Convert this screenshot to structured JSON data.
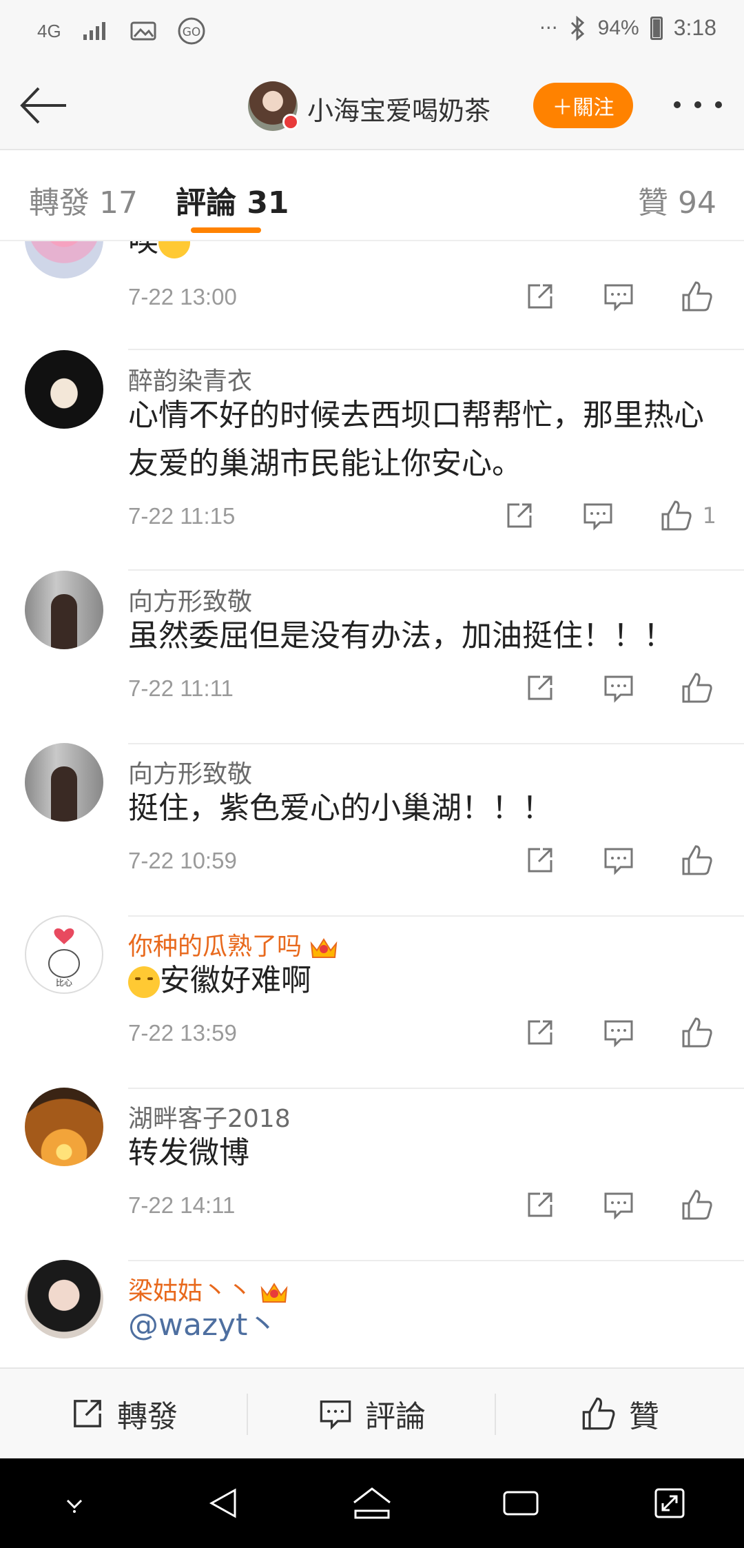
{
  "status_bar": {
    "network": "4G",
    "battery_percent": "94%",
    "time": "3:18",
    "icons": [
      "signal-icon",
      "image-icon",
      "go-icon",
      "dots-icon",
      "bluetooth-icon",
      "battery-icon"
    ]
  },
  "header": {
    "username": "小海宝爱喝奶茶",
    "follow_label": "＋關注"
  },
  "tabs": [
    {
      "label": "轉發 17"
    },
    {
      "label": "評論 31",
      "active": true
    },
    {
      "label": "贊 94"
    }
  ],
  "comments": [
    {
      "user": "",
      "text": "唉",
      "time": "7-22 13:00",
      "likes": ""
    },
    {
      "user": "醉韵染青衣",
      "text": "心情不好的时候去西坝口帮帮忙，那里热心友爱的巢湖市民能让你安心。",
      "time": "7-22 11:15",
      "likes": "1"
    },
    {
      "user": "向方形致敬",
      "text": "虽然委屈但是没有办法，加油挺住！！！",
      "time": "7-22 11:11",
      "likes": ""
    },
    {
      "user": "向方形致敬",
      "text": "挺住，紫色爱心的小巢湖！！！",
      "time": "7-22 10:59",
      "likes": ""
    },
    {
      "user": "你种的瓜熟了吗",
      "text": "安徽好难啊",
      "time": "7-22 13:59",
      "likes": ""
    },
    {
      "user": "湖畔客子2018",
      "text": "转发微博",
      "time": "7-22 14:11",
      "likes": ""
    },
    {
      "user": "梁姑姑丶丶",
      "text": "@wazyt丶",
      "time": "",
      "likes": ""
    }
  ],
  "bottom_bar": {
    "repost_label": "轉發",
    "comment_label": "評論",
    "like_label": "贊"
  },
  "colors": {
    "accent": "#ff8200",
    "vip_name": "#e8691d",
    "mention": "#4e6fa0"
  }
}
